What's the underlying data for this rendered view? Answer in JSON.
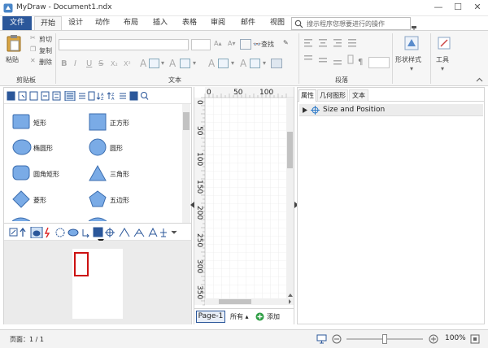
{
  "app": {
    "title": "MyDraw - Document1.ndx",
    "window": {
      "minimize": "—",
      "maximize": "☐",
      "close": "✕"
    }
  },
  "ribbon_tabs": [
    "文件",
    "开始",
    "设计",
    "动作",
    "布局",
    "插入",
    "表格",
    "审阅",
    "邮件",
    "视图"
  ],
  "search": {
    "placeholder": "搜示程序您想要进行的操作"
  },
  "ribbon": {
    "clipboard": {
      "paste": "粘贴",
      "cut": "剪切",
      "copy": "复制",
      "delete": "删除",
      "group": "剪贴板"
    },
    "font": {
      "group": "文本",
      "bold": "B",
      "italic": "I",
      "underline": "U",
      "strike": "S",
      "sub": "X₂",
      "sup": "X²",
      "find": "查找"
    },
    "paragraph": {
      "group": "段落",
      "pilcrow": "¶"
    },
    "shape_style": {
      "label": "形状样式"
    },
    "tools": {
      "label": "工具"
    }
  },
  "shapes": [
    {
      "label": "矩形",
      "icon": "rectangle-icon"
    },
    {
      "label": "正方形",
      "icon": "square-icon"
    },
    {
      "label": "椭圆形",
      "icon": "ellipse-icon"
    },
    {
      "label": "圆形",
      "icon": "circle-icon"
    },
    {
      "label": "圆角矩形",
      "icon": "rounded-rectangle-icon"
    },
    {
      "label": "三角形",
      "icon": "triangle-icon"
    },
    {
      "label": "菱形",
      "icon": "diamond-icon"
    },
    {
      "label": "五边形",
      "icon": "pentagon-icon"
    }
  ],
  "ruler": {
    "horizontal": [
      "0",
      "50",
      "100"
    ],
    "vertical": [
      "0",
      "50",
      "100",
      "150",
      "200",
      "250",
      "300",
      "350"
    ]
  },
  "page_tabs": {
    "page": "Page-1",
    "all": "所有 ▴",
    "add": "添加"
  },
  "properties": {
    "tabs": [
      "属性",
      "几何图形",
      "文本"
    ],
    "section": "Size and Position"
  },
  "status": {
    "page": "页面：1 / 1",
    "zoom": "100%"
  },
  "colors": {
    "accent": "#2b579a",
    "shape_fill": "#7aabe6",
    "shape_stroke": "#3c6eaf",
    "selection": "#cc1111"
  }
}
